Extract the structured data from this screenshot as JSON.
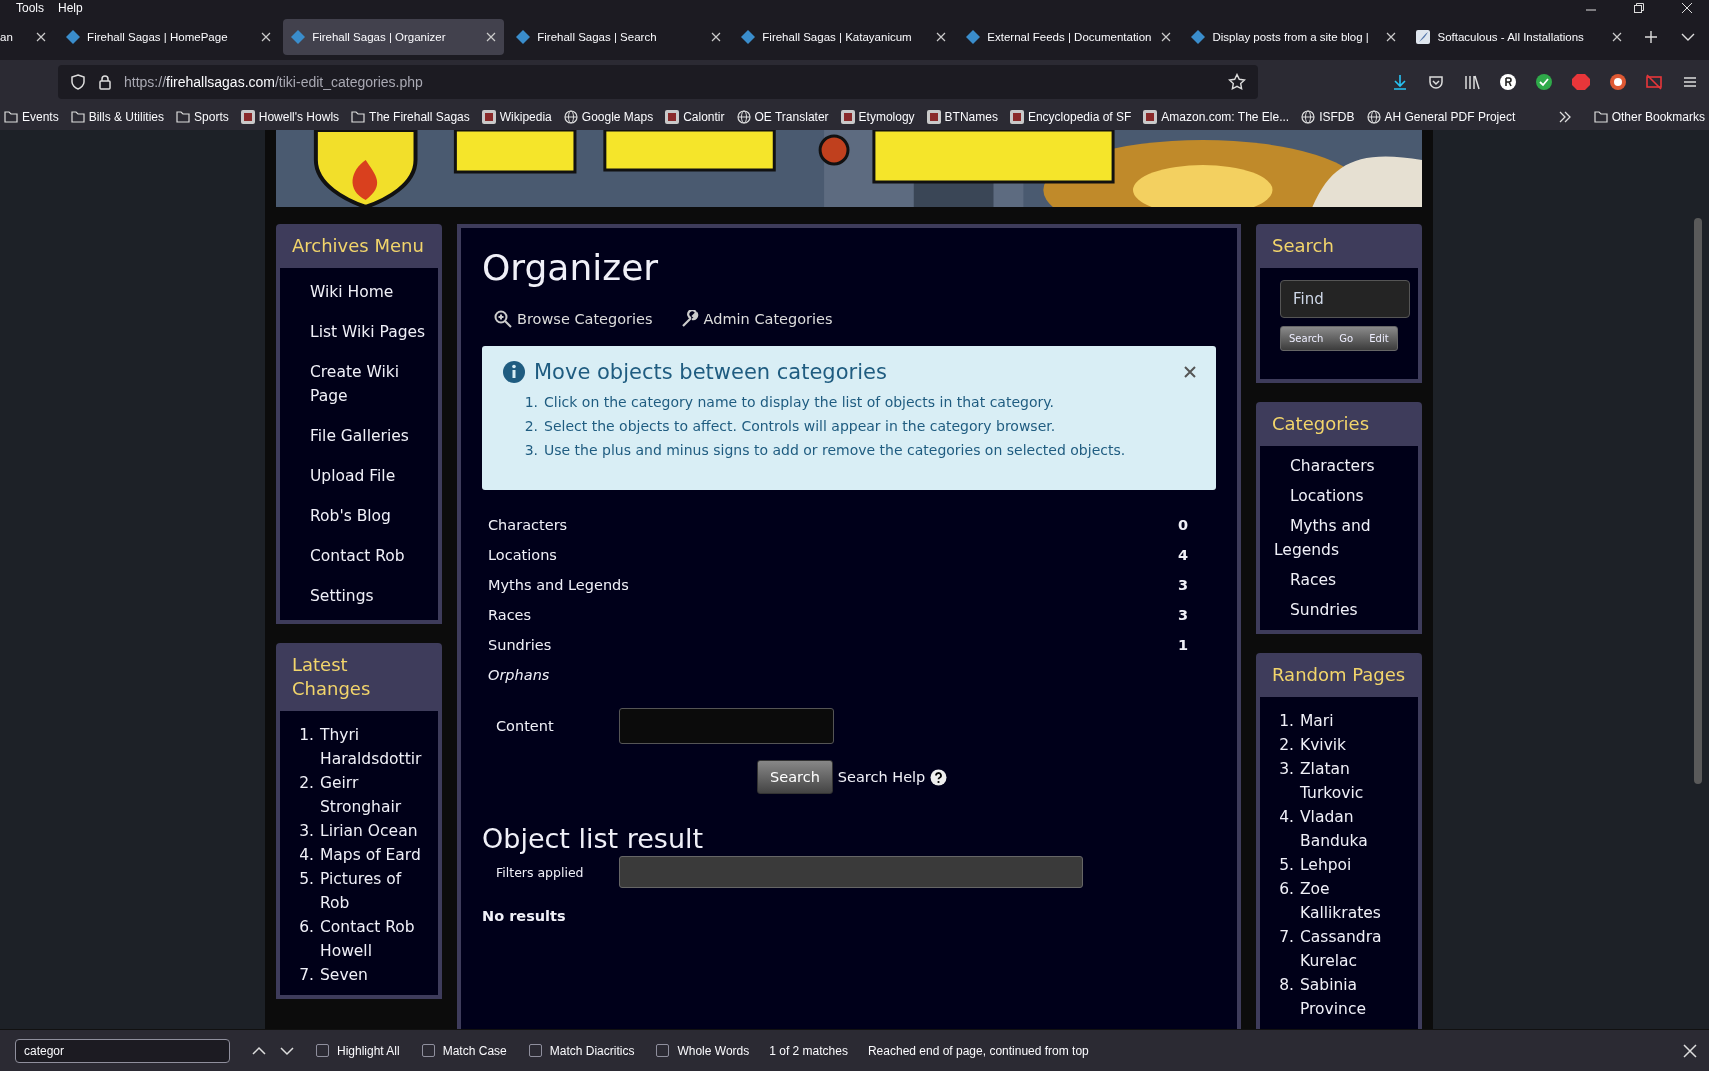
{
  "menu_bar": [
    "Tools",
    "Help"
  ],
  "tabs": [
    {
      "title": "an",
      "selected": false,
      "kind": "plain"
    },
    {
      "title": "Firehall Sagas | HomePage",
      "selected": false,
      "kind": "tiki"
    },
    {
      "title": "Firehall Sagas | Organizer",
      "selected": true,
      "kind": "tiki"
    },
    {
      "title": "Firehall Sagas | Search",
      "selected": false,
      "kind": "tiki"
    },
    {
      "title": "Firehall Sagas | Katayanicum",
      "selected": false,
      "kind": "tiki"
    },
    {
      "title": "External Feeds | Documentation",
      "selected": false,
      "kind": "tiki"
    },
    {
      "title": "Display posts from a site blog |",
      "selected": false,
      "kind": "tiki"
    },
    {
      "title": "Softaculous - All Installations",
      "selected": false,
      "kind": "installer"
    }
  ],
  "address_bar": {
    "url_host": "https://firehallsagas.com",
    "url_path": "/tiki-edit_categories.php"
  },
  "bookmarks": [
    {
      "label": "Events",
      "kind": "folder"
    },
    {
      "label": "Bills & Utilities",
      "kind": "folder"
    },
    {
      "label": "Sports",
      "kind": "folder"
    },
    {
      "label": "Howell's Howls",
      "kind": "site"
    },
    {
      "label": "The Firehall Sagas",
      "kind": "folder"
    },
    {
      "label": "Wikipedia",
      "kind": "site"
    },
    {
      "label": "Google Maps",
      "kind": "globe"
    },
    {
      "label": "Calontir",
      "kind": "site"
    },
    {
      "label": "OE Translater",
      "kind": "globe"
    },
    {
      "label": "Etymology",
      "kind": "site"
    },
    {
      "label": "BTNames",
      "kind": "site"
    },
    {
      "label": "Encyclopedia of SF",
      "kind": "site"
    },
    {
      "label": "Amazon.com: The Ele...",
      "kind": "site"
    },
    {
      "label": "ISFDB",
      "kind": "globe"
    },
    {
      "label": "AH General PDF Project",
      "kind": "globe"
    }
  ],
  "other_bookmarks": "Other Bookmarks",
  "archives_menu": {
    "title": "Archives Menu",
    "items": [
      "Wiki Home",
      "List Wiki Pages",
      "Create Wiki Page",
      "File Galleries",
      "Upload File",
      "Rob's Blog",
      "Contact Rob",
      "Settings"
    ]
  },
  "latest_changes": {
    "title": "Latest Changes",
    "items": [
      {
        "number": "1.",
        "label": "Thyri Haraldsdottir"
      },
      {
        "number": "2.",
        "label": "Geirr Stronghair"
      },
      {
        "number": "3.",
        "label": "Lirian Ocean"
      },
      {
        "number": "4.",
        "label": "Maps of Eard"
      },
      {
        "number": "5.",
        "label": "Pictures of Rob"
      },
      {
        "number": "6.",
        "label": "Contact Rob Howell"
      },
      {
        "number": "7.",
        "label": "Seven"
      }
    ]
  },
  "organizer": {
    "title": "Organizer",
    "links": [
      "Browse Categories",
      "Admin Categories"
    ],
    "info": {
      "title": "Move objects between categories",
      "steps": [
        {
          "number": "1.",
          "text": "Click on the category name to display the list of objects in that category."
        },
        {
          "number": "2.",
          "text": "Select the objects to affect. Controls will appear in the category browser."
        },
        {
          "number": "3.",
          "text": "Use the plus and minus signs to add or remove the categories on selected objects."
        }
      ]
    },
    "categories": [
      {
        "name": "Characters",
        "count": "0",
        "kind": "category"
      },
      {
        "name": "Locations",
        "count": "4",
        "kind": "category"
      },
      {
        "name": "Myths and Legends",
        "count": "3",
        "kind": "category"
      },
      {
        "name": "Races",
        "count": "3",
        "kind": "category"
      },
      {
        "name": "Sundries",
        "count": "1",
        "kind": "category"
      },
      {
        "name": "Orphans",
        "kind": "orphans"
      }
    ],
    "content_label": "Content",
    "search_button": "Search",
    "search_help": "Search Help",
    "result_title": "Object list result",
    "filters_label": "Filters applied",
    "no_results": "No results"
  },
  "search_panel": {
    "title": "Search",
    "placeholder": "Find",
    "buttons": [
      "Search",
      "Go",
      "Edit"
    ]
  },
  "categories_panel": {
    "title": "Categories",
    "items": [
      "Characters",
      "Locations",
      "Myths and Legends",
      "Races",
      "Sundries"
    ]
  },
  "random_pages": {
    "title": "Random Pages",
    "items": [
      {
        "number": "1.",
        "label": "Mari"
      },
      {
        "number": "2.",
        "label": "Kvivik"
      },
      {
        "number": "3.",
        "label": "Zlatan Turkovic"
      },
      {
        "number": "4.",
        "label": "Vladan Banduka"
      },
      {
        "number": "5.",
        "label": "Lehpoi"
      },
      {
        "number": "6.",
        "label": "Zoe Kallikrates"
      },
      {
        "number": "7.",
        "label": "Cassandra Kurelac"
      },
      {
        "number": "8.",
        "label": "Sabinia Province"
      }
    ]
  },
  "find_bar": {
    "value": "categor",
    "options": [
      {
        "label": "Highlight All",
        "checked": false
      },
      {
        "label": "Match Case",
        "checked": false
      },
      {
        "label": "Match Diacritics",
        "checked": false
      },
      {
        "label": "Whole Words",
        "checked": false
      }
    ],
    "matches": "1 of 2 matches",
    "status": "Reached end of page, continued from top"
  }
}
